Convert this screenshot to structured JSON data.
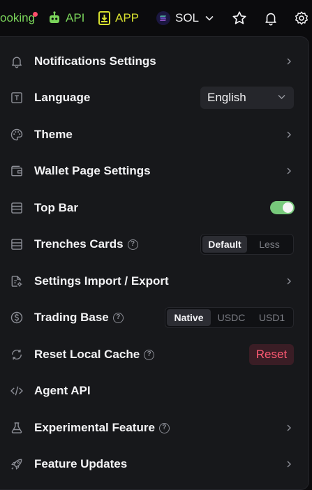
{
  "topbar": {
    "cooking_label": "ooking",
    "api_label": "API",
    "app_label": "APP",
    "chain_label": "SOL"
  },
  "settings": {
    "notifications": "Notifications Settings",
    "language": "Language",
    "language_value": "English",
    "theme": "Theme",
    "wallet_page": "Wallet Page Settings",
    "top_bar": "Top Bar",
    "top_bar_enabled": true,
    "trenches_cards": "Trenches Cards",
    "trenches_options": [
      "Default",
      "Less"
    ],
    "trenches_selected": "Default",
    "import_export": "Settings Import / Export",
    "trading_base": "Trading Base",
    "trading_base_options": [
      "Native",
      "USDC",
      "USD1"
    ],
    "trading_base_selected": "Native",
    "reset_cache": "Reset Local Cache",
    "reset_button": "Reset",
    "agent_api": "Agent API",
    "experimental": "Experimental Feature",
    "feature_updates": "Feature Updates"
  },
  "colors": {
    "accent_green": "#7ad45a",
    "app_yellow": "#d7e02f",
    "toggle_on": "#77c97b",
    "danger": "#ff5a73",
    "panel_bg": "#17181b"
  }
}
